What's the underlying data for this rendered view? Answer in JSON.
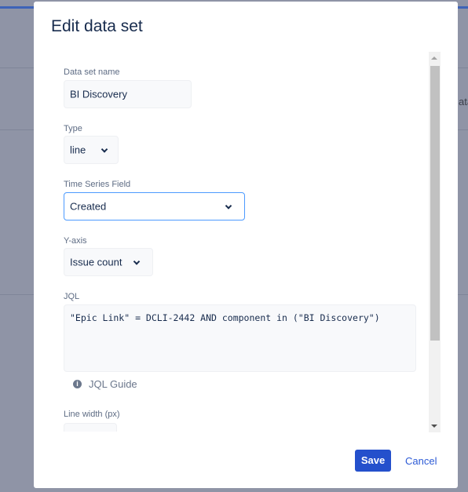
{
  "background": {
    "partial_text": "ata"
  },
  "dialog": {
    "title": "Edit data set",
    "fields": {
      "name_label": "Data set name",
      "name_value": "BI Discovery",
      "type_label": "Type",
      "type_value": "line",
      "time_label": "Time Series Field",
      "time_value": "Created",
      "yaxis_label": "Y-axis",
      "yaxis_value": "Issue count",
      "jql_label": "JQL",
      "jql_value": "\"Epic Link\" = DCLI-2442 AND component in (\"BI Discovery\")",
      "jql_guide": "JQL Guide",
      "linewidth_label": "Line width (px)"
    },
    "save_label": "Save",
    "cancel_label": "Cancel"
  },
  "colors": {
    "primary": "#2450cc",
    "focus_border": "#4c9aff",
    "overlay": "#8f94a6"
  }
}
